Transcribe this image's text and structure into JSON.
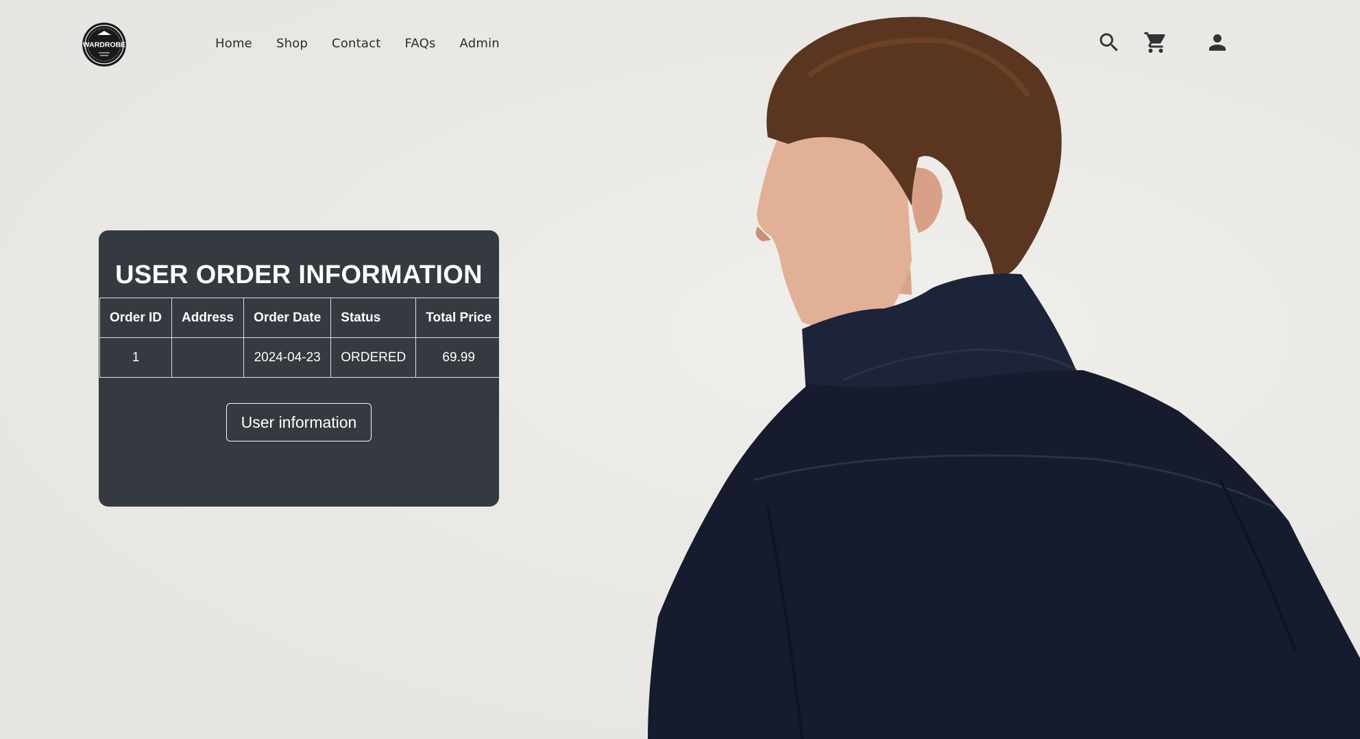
{
  "brand": {
    "logo_icon": "wardrobe-logo",
    "logo_text": "WARDROBE"
  },
  "nav": {
    "items": [
      {
        "label": "Home"
      },
      {
        "label": "Shop"
      },
      {
        "label": "Contact"
      },
      {
        "label": "FAQs"
      },
      {
        "label": "Admin"
      }
    ]
  },
  "header_icons": [
    "search-icon",
    "cart-icon",
    "user-icon"
  ],
  "order_card": {
    "title": "USER ORDER INFORMATION",
    "columns": [
      "Order ID",
      "Address",
      "Order Date",
      "Status",
      "Total Price"
    ],
    "rows": [
      {
        "order_id": "1",
        "address": "",
        "order_date": "2024-04-23",
        "status": "ORDERED",
        "total_price": "69.99"
      }
    ],
    "button_label": "User information"
  },
  "colors": {
    "background": "#ebe9e5",
    "card": "#343a40",
    "card_text": "#ffffff",
    "nav_text": "#2c2c2c",
    "jacket": "#161b2e",
    "hair": "#5a3520"
  }
}
